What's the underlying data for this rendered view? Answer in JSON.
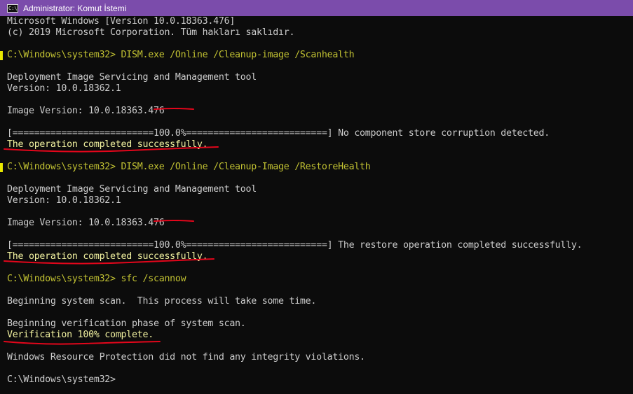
{
  "window": {
    "title": "Administrator: Komut İstemi",
    "icon": "cmd-icon",
    "icon_glyph": "C:\\"
  },
  "console": {
    "lines": [
      "Microsoft Windows [Version 10.0.18363.476]",
      "(c) 2019 Microsoft Corporation. Tüm hakları saklıdır.",
      "",
      "C:\\Windows\\system32> DISM.exe /Online /Cleanup-image /Scanhealth",
      "",
      "Deployment Image Servicing and Management tool",
      "Version: 10.0.18362.1",
      "",
      "Image Version: 10.0.18363.476",
      "",
      "[==========================100.0%==========================] No component store corruption detected.",
      "The operation completed successfully.",
      "",
      "C:\\Windows\\system32> DISM.exe /Online /Cleanup-Image /RestoreHealth",
      "",
      "Deployment Image Servicing and Management tool",
      "Version: 10.0.18362.1",
      "",
      "Image Version: 10.0.18363.476",
      "",
      "[==========================100.0%==========================] The restore operation completed successfully.",
      "The operation completed successfully.",
      "",
      "C:\\Windows\\system32> sfc /scannow",
      "",
      "Beginning system scan.  This process will take some time.",
      "",
      "Beginning verification phase of system scan.",
      "Verification 100% complete.",
      "",
      "Windows Resource Protection did not find any integrity violations.",
      "",
      "C:\\Windows\\system32>"
    ]
  },
  "colors": {
    "titlebar": "#7b4cab",
    "background": "#0c0c0c",
    "text": "#cccccc",
    "prompt": "#c1c132",
    "annotation": "#e3061b"
  }
}
